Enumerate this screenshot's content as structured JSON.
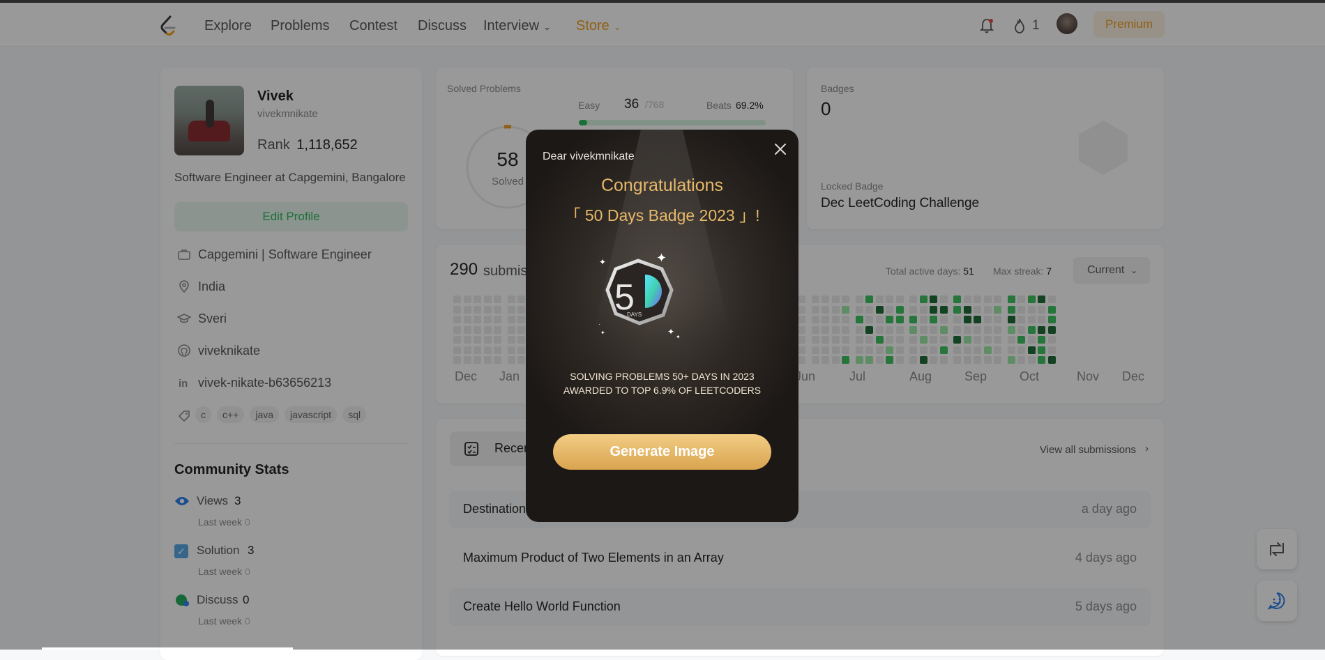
{
  "nav": {
    "links": [
      "Explore",
      "Problems",
      "Contest",
      "Discuss",
      "Interview",
      "Store"
    ],
    "streak": "1",
    "premium": "Premium"
  },
  "profile": {
    "name": "Vivek",
    "username": "vivekmnikate",
    "rank_label": "Rank",
    "rank_value": "1,118,652",
    "bio": "Software Engineer at Capgemini, Bangalore",
    "edit_button": "Edit Profile",
    "company": "Capgemini | Software Engineer",
    "location": "India",
    "school": "Sveri",
    "github": "viveknikate",
    "linkedin": "vivek-nikate-b63656213",
    "skills": [
      "c",
      "c++",
      "java",
      "javascript",
      "sql"
    ]
  },
  "community": {
    "title": "Community Stats",
    "items": [
      {
        "label": "Views",
        "value": "3",
        "sub": "Last week",
        "sub_value": "0"
      },
      {
        "label": "Solution",
        "value": "3",
        "sub": "Last week",
        "sub_value": "0"
      },
      {
        "label": "Discuss",
        "value": "0",
        "sub": "Last week",
        "sub_value": "0"
      }
    ]
  },
  "solved": {
    "title": "Solved Problems",
    "count": "58",
    "count_label": "Solved",
    "easy_label": "Easy",
    "easy_count": "36",
    "easy_total": "/768",
    "beats_label": "Beats",
    "beats_value": "69.2%"
  },
  "badges": {
    "title": "Badges",
    "count": "0",
    "locked_label": "Locked Badge",
    "locked_name": "Dec LeetCoding Challenge"
  },
  "calendar": {
    "submissions_count": "290",
    "submissions_text": "submis",
    "active_label": "Total active days:",
    "active_value": "51",
    "streak_label": "Max streak:",
    "streak_value": "7",
    "select": "Current",
    "months": [
      "Dec",
      "Jan",
      "Jun",
      "Jul",
      "Aug",
      "Sep",
      "Oct",
      "Nov",
      "Dec"
    ]
  },
  "recent": {
    "tab": "Recen",
    "view_all": "View all submissions",
    "rows": [
      {
        "title": "Destination",
        "time": "a day ago"
      },
      {
        "title": "Maximum Product of Two Elements in an Array",
        "time": "4 days ago"
      },
      {
        "title": "Create Hello World Function",
        "time": "5 days ago"
      }
    ]
  },
  "modal": {
    "greeting": "Dear vivekmnikate",
    "congrats": "Congratulations",
    "badge_name": "「 50 Days Badge 2023 」!",
    "badge_number": "5",
    "badge_days": "DAYS",
    "desc_line1": "SOLVING PROBLEMS 50+ DAYS IN 2023",
    "desc_line2": "AWARDED TO TOP 6.9% OF LEETCODERS",
    "button": "Generate Image"
  },
  "colors": {
    "accent_green": "#2cbb5d",
    "store_orange": "#f0a020",
    "gold": "#e7b86a"
  }
}
